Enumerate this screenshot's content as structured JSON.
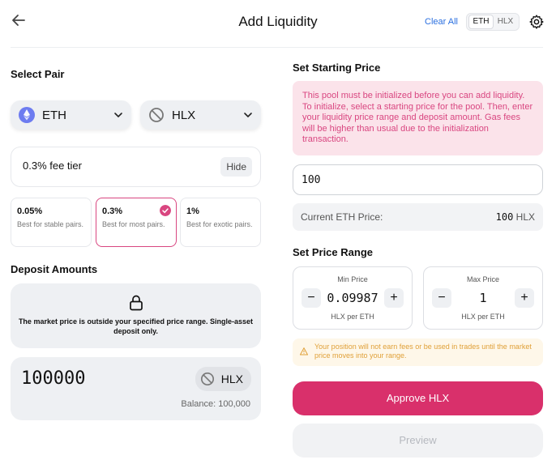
{
  "header": {
    "title": "Add Liquidity",
    "clear_all": "Clear All",
    "toggle": [
      "ETH",
      "HLX"
    ]
  },
  "select_pair": {
    "title": "Select Pair",
    "token_a": {
      "symbol": "ETH",
      "icon": "eth-icon"
    },
    "token_b": {
      "symbol": "HLX",
      "icon": "no-logo-icon"
    }
  },
  "fee": {
    "label": "0.3% fee tier",
    "hide_label": "Hide",
    "tiers": [
      {
        "pct": "0.05%",
        "desc": "Best for stable pairs.",
        "selected": false
      },
      {
        "pct": "0.3%",
        "desc": "Best for most pairs.",
        "selected": true
      },
      {
        "pct": "1%",
        "desc": "Best for exotic pairs.",
        "selected": false
      }
    ]
  },
  "deposit": {
    "title": "Deposit Amounts",
    "notice": "The market price is outside your specified price range. Single-asset deposit only.",
    "amount": "100000",
    "token": "HLX",
    "balance": "Balance: 100,000"
  },
  "starting_price": {
    "title": "Set Starting Price",
    "warning": "This pool must be initialized before you can add liquidity. To initialize, select a starting price for the pool. Then, enter your liquidity price range and deposit amount. Gas fees will be higher than usual due to the initialization transaction.",
    "value": "100",
    "current_label": "Current ETH Price:",
    "current_value": "100",
    "current_unit": "HLX"
  },
  "price_range": {
    "title": "Set Price Range",
    "min": {
      "label": "Min Price",
      "value": "0.09987",
      "unit": "HLX per ETH"
    },
    "max": {
      "label": "Max Price",
      "value": "1",
      "unit": "HLX per ETH"
    },
    "warning": "Your position will not earn fees or be used in trades until the market price moves into your range."
  },
  "actions": {
    "approve": "Approve HLX",
    "preview": "Preview"
  },
  "colors": {
    "accent": "#d9306b",
    "warning_text": "#d94680",
    "warning_bg": "#fbe3ea",
    "link": "#2a6fe0"
  }
}
